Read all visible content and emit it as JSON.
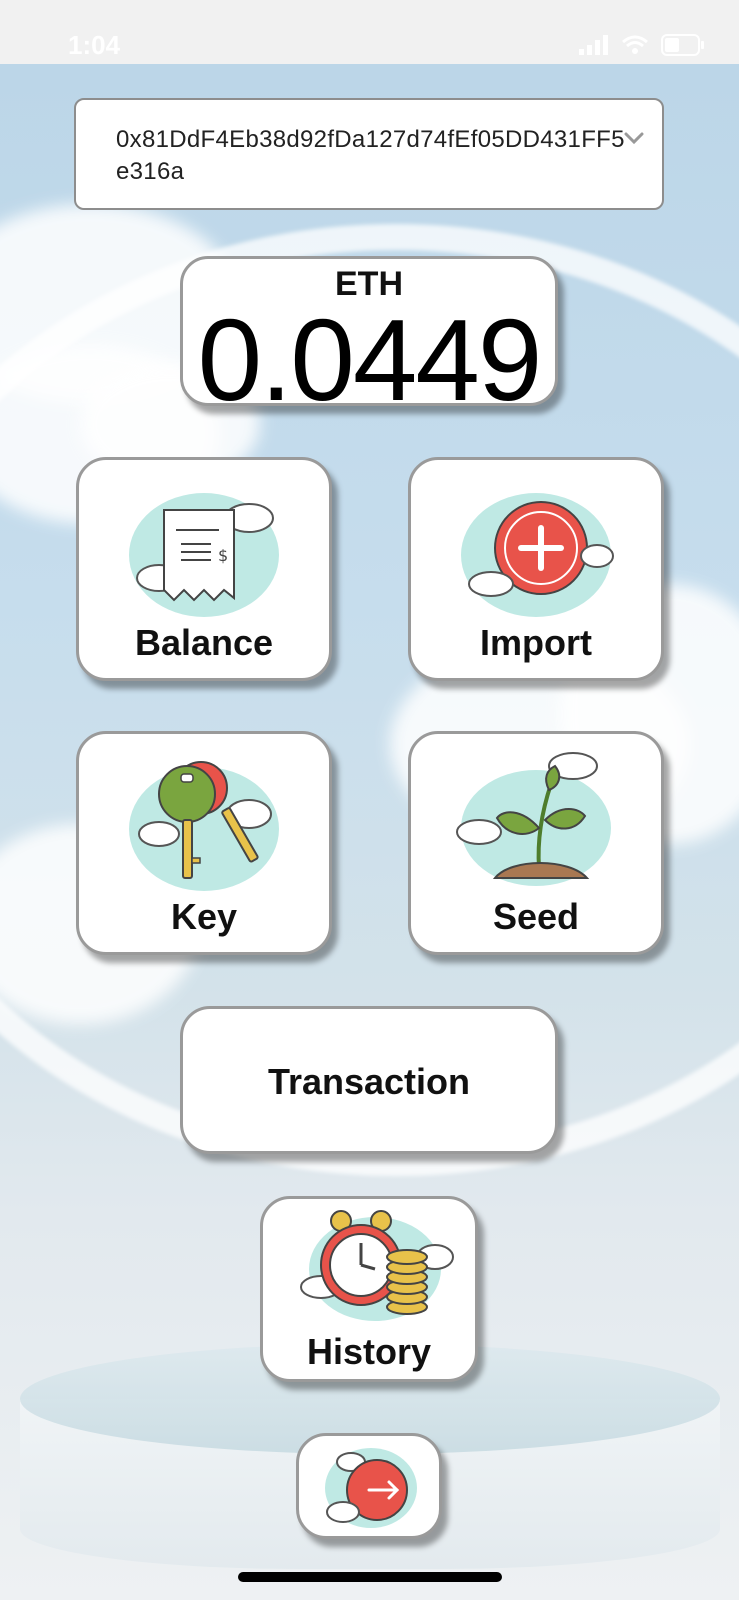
{
  "status_bar": {
    "time": "1:04"
  },
  "account": {
    "address": "0x81DdF4Eb38d92fDa127d74fEf05DD431FF5e316a"
  },
  "balance": {
    "currency": "ETH",
    "value": "0.0449"
  },
  "tiles": {
    "balance": "Balance",
    "import": "Import",
    "key": "Key",
    "seed": "Seed",
    "transaction": "Transaction",
    "history": "History"
  },
  "icons": {
    "balance": "receipt-icon",
    "import": "add-circle-icon",
    "key": "keys-icon",
    "seed": "sprout-icon",
    "history": "clock-coins-icon",
    "logout": "arrow-right-circle-icon"
  },
  "colors": {
    "accent_red": "#e8534a",
    "mint": "#bfe9e4"
  }
}
